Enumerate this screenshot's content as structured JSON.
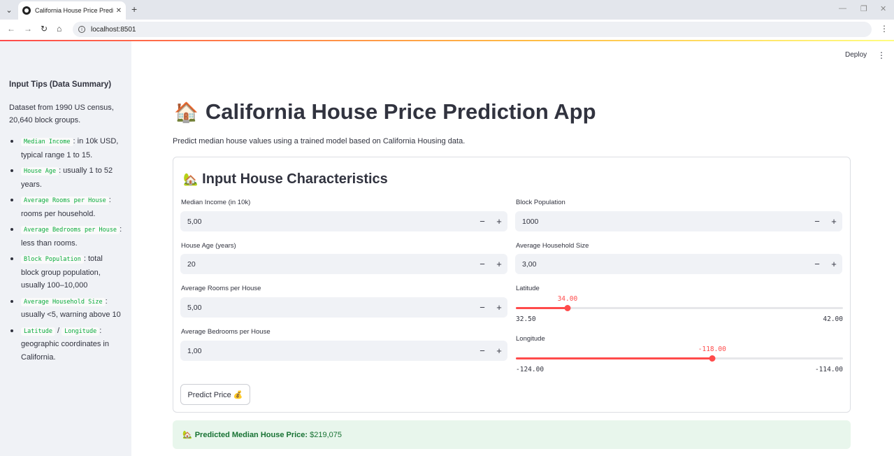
{
  "browser": {
    "tab_title": "California House Price Predictor",
    "url": "localhost:8501"
  },
  "header": {
    "deploy_label": "Deploy"
  },
  "sidebar": {
    "title": "Input Tips (Data Summary)",
    "intro": "Dataset from 1990 US census, 20,640 block groups.",
    "tips": [
      {
        "code": "Median Income",
        "text": ": in 10k USD, typical range 1 to 15."
      },
      {
        "code": "House Age",
        "text": ": usually 1 to 52 years."
      },
      {
        "code": "Average Rooms per House",
        "text": ": rooms per household."
      },
      {
        "code": "Average Bedrooms per House",
        "text": ": less than rooms."
      },
      {
        "code": "Block Population",
        "text": ": total block group population, usually 100–10,000"
      },
      {
        "code": "Average Household Size",
        "text": ": usually <5, warning above 10"
      },
      {
        "code": "Latitude",
        "code2": "Longitude",
        "sep": " / ",
        "text": ": geographic coordinates in California."
      }
    ]
  },
  "main": {
    "title_emoji": "🏠",
    "title": "California House Price Prediction App",
    "subtitle": "Predict median house values using a trained model based on California Housing data."
  },
  "form": {
    "title_emoji": "🏡",
    "title": "Input House Characteristics",
    "inputs": {
      "median_income": {
        "label": "Median Income (in 10k)",
        "value": "5,00"
      },
      "house_age": {
        "label": "House Age (years)",
        "value": "20"
      },
      "avg_rooms": {
        "label": "Average Rooms per House",
        "value": "5,00"
      },
      "avg_bedrooms": {
        "label": "Average Bedrooms per House",
        "value": "1,00"
      },
      "block_population": {
        "label": "Block Population",
        "value": "1000"
      },
      "avg_household_size": {
        "label": "Average Household Size",
        "value": "3,00"
      }
    },
    "sliders": {
      "latitude": {
        "label": "Latitude",
        "value": 34.0,
        "value_text": "34.00",
        "min": 32.5,
        "min_text": "32.50",
        "max": 42.0,
        "max_text": "42.00"
      },
      "longitude": {
        "label": "Longitude",
        "value": -118.0,
        "value_text": "-118.00",
        "min": -124.0,
        "min_text": "-124.00",
        "max": -114.0,
        "max_text": "-114.00"
      }
    },
    "predict_label": "Predict Price 💰"
  },
  "result": {
    "emoji": "🏡",
    "label": "Predicted Median House Price:",
    "value": "$219,075"
  },
  "colors": {
    "accent": "#ff4b4b",
    "success_bg": "#e8f6ec",
    "success_text": "#177233",
    "sidebar_bg": "#f0f2f6"
  }
}
